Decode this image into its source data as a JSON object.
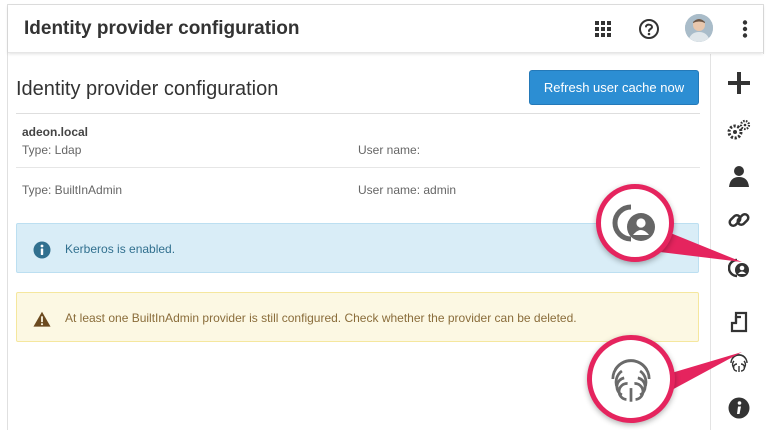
{
  "appbar": {
    "title": "Identity provider configuration",
    "icons": [
      "apps-grid-icon",
      "help-icon",
      "user-avatar",
      "more-vertical-icon"
    ]
  },
  "page": {
    "title": "Identity provider configuration",
    "refresh_button": "Refresh user cache now"
  },
  "providers": [
    {
      "name": "adeon.local",
      "type": "Type: Ldap",
      "user": "User name:"
    },
    {
      "name": "",
      "type": "Type: BuiltInAdmin",
      "user": "User name: admin"
    }
  ],
  "alerts": {
    "info": "Kerberos is enabled.",
    "warning": "At least one BuiltInAdmin provider is still configured. Check whether the provider can be deleted."
  },
  "sidebar": {
    "items": [
      "add-icon",
      "settings-gears-icon",
      "user-icon",
      "link-icon",
      "identity-provider-icon",
      "mapping-icon",
      "fingerprint-icon",
      "info-icon"
    ]
  },
  "colors": {
    "primary_button": "#2c8ed3",
    "info_bg": "#d9edf7",
    "warning_bg": "#fcf8e3",
    "callout_accent": "#e5245e"
  }
}
